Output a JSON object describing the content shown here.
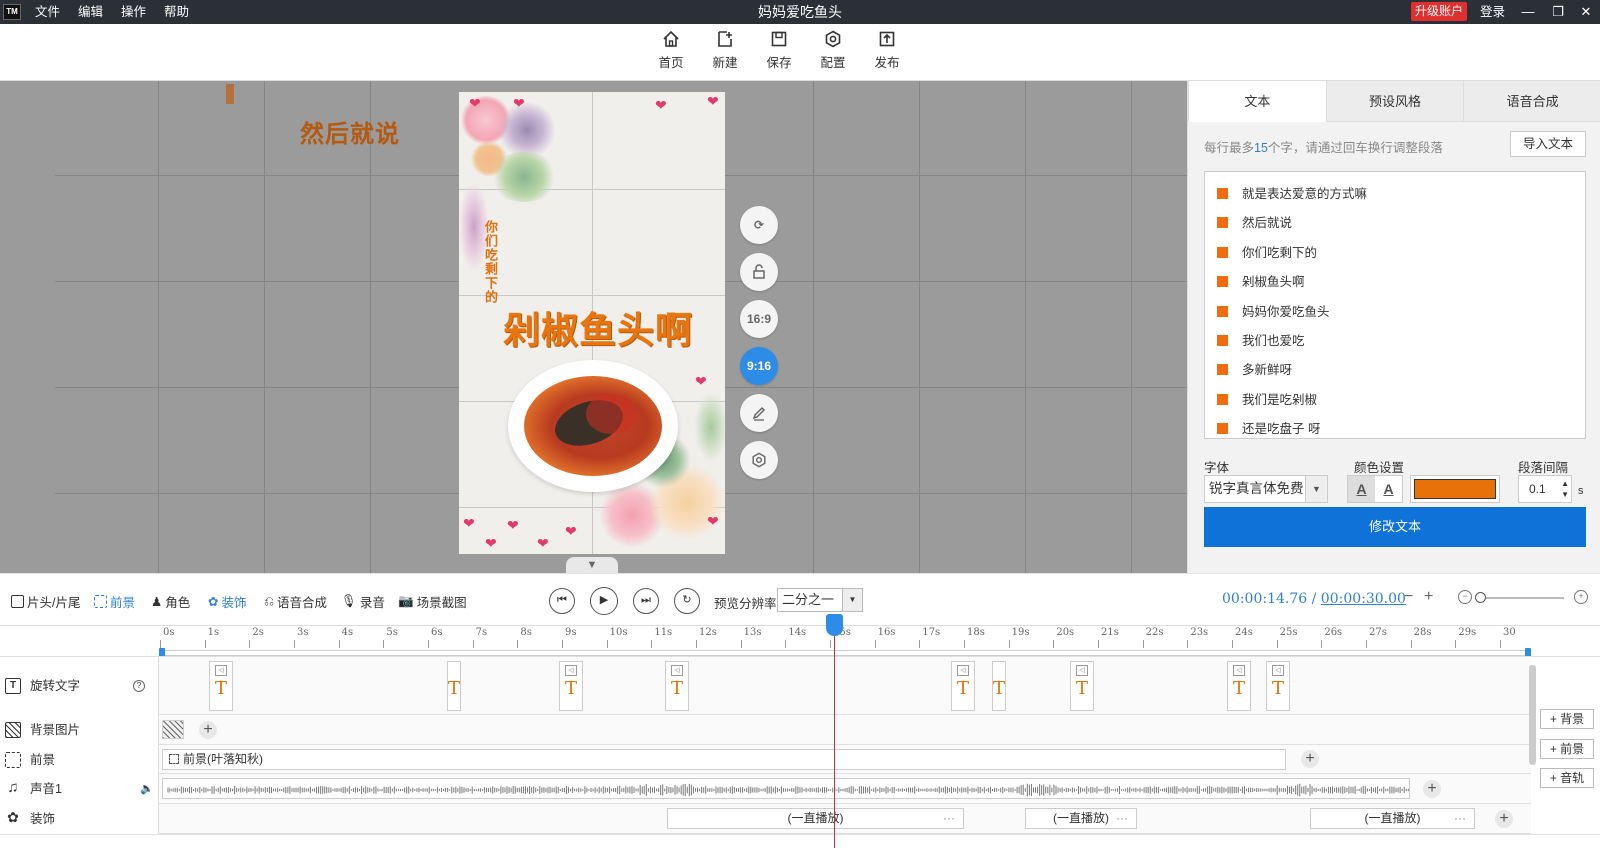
{
  "titlebar": {
    "logo": "TM",
    "title": "妈妈爱吃鱼头",
    "menu": [
      "文件",
      "编辑",
      "操作",
      "帮助"
    ],
    "upgrade": "升级账户",
    "login": "登录"
  },
  "toolbar": {
    "home": "首页",
    "new": "新建",
    "save": "保存",
    "config": "配置",
    "publish": "发布"
  },
  "stage": {
    "ghost_text": "然后就说",
    "vertical_text": "你们吃剩下的",
    "main_text": "剁椒鱼头啊",
    "ratio_16_9": "16:9",
    "ratio_9_16": "9:16"
  },
  "panel": {
    "tabs": [
      "文本",
      "预设风格",
      "语音合成"
    ],
    "hint_pre": "每行最多",
    "hint_num": "15",
    "hint_post": "个字，请通过回车换行调整段落",
    "import": "导入文本",
    "lines": [
      "就是表达爱意的方式嘛",
      "然后就说",
      "你们吃剩下的",
      "剁椒鱼头啊",
      "妈妈你爱吃鱼头",
      "我们也爱吃",
      "多新鲜呀",
      "我们是吃剁椒",
      "还是吃盘子  呀"
    ],
    "font_label": "字体",
    "font_value": "锐字真言体免费",
    "color_label": "颜色设置",
    "spacing_label": "段落间隔",
    "spacing_value": "0.1",
    "spacing_unit": "s",
    "color_value": "#e8710a",
    "modify": "修改文本"
  },
  "controls": {
    "tools": [
      "片头/片尾",
      "前景",
      "角色",
      "装饰",
      "语音合成",
      "录音",
      "场景截图"
    ],
    "res_label": "预览分辨率",
    "res_value": "二分之一",
    "time_current": "00:00:14.76",
    "time_sep": "/",
    "time_total": "00:00:30.00"
  },
  "timeline": {
    "ticks": [
      "0s",
      "1s",
      "2s",
      "3s",
      "4s",
      "5s",
      "6s",
      "7s",
      "8s",
      "9s",
      "10s",
      "11s",
      "12s",
      "13s",
      "14s",
      "15s",
      "16s",
      "17s",
      "18s",
      "19s",
      "20s",
      "21s",
      "22s",
      "23s",
      "24s",
      "25s",
      "26s",
      "27s",
      "28s",
      "29s",
      "30"
    ],
    "tracks": {
      "rotate_text": "旋转文字",
      "background": "背景图片",
      "foreground": "前景",
      "audio": "声音1",
      "decoration": "装饰"
    },
    "foreground_clip": "前景(叶落知秋)",
    "deco_clip": "(一直播放)",
    "add_background": "背景",
    "add_foreground": "前景",
    "add_audio": "音轨"
  }
}
